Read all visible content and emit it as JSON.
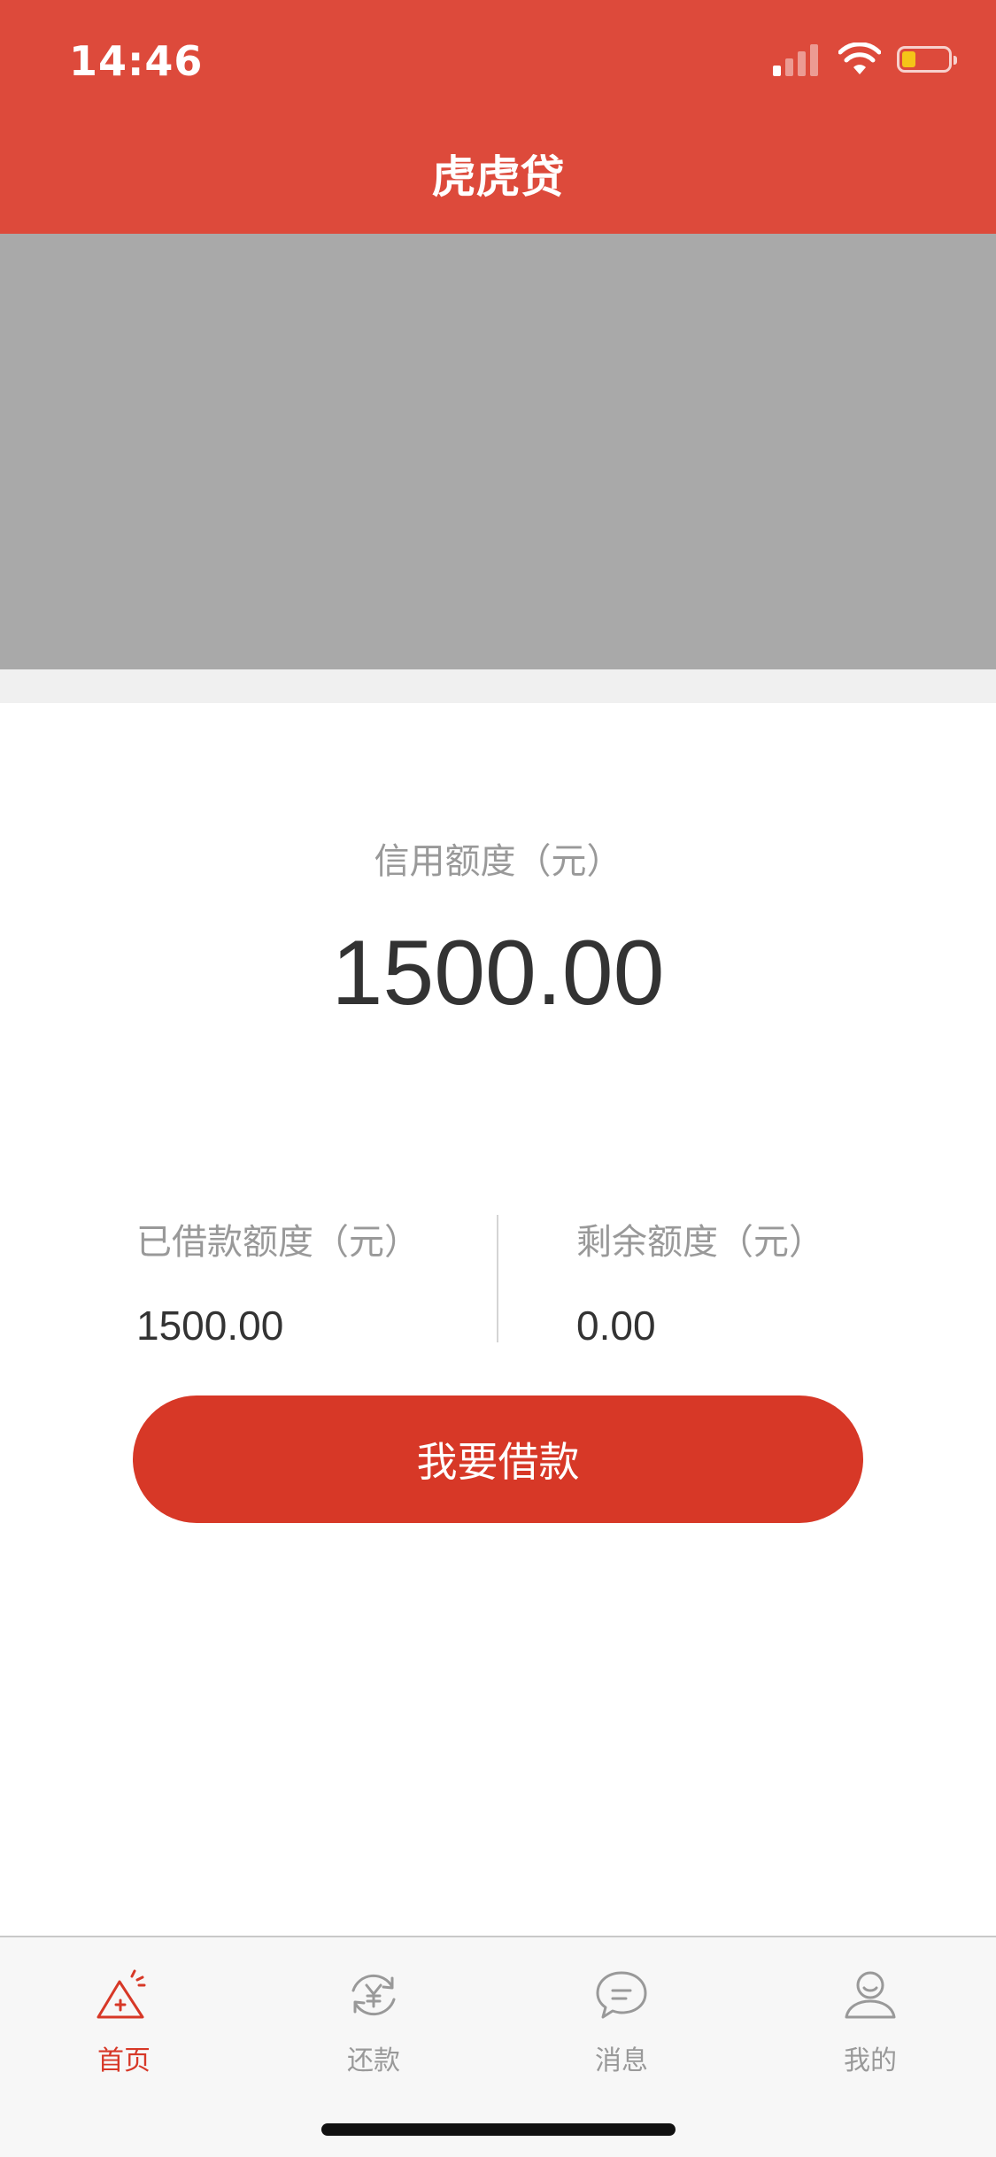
{
  "status_bar": {
    "time": "14:46"
  },
  "nav": {
    "title": "虎虎贷"
  },
  "credit": {
    "label": "信用额度（元）",
    "amount": "1500.00"
  },
  "stats": {
    "borrowed": {
      "label": "已借款额度（元）",
      "value": "1500.00"
    },
    "remaining": {
      "label": "剩余额度（元）",
      "value": "0.00"
    }
  },
  "borrow_button": "我要借款",
  "tabbar": {
    "items": [
      {
        "label": "首页",
        "icon": "home-icon",
        "active": true
      },
      {
        "label": "还款",
        "icon": "repay-icon",
        "active": false
      },
      {
        "label": "消息",
        "icon": "message-icon",
        "active": false
      },
      {
        "label": "我的",
        "icon": "profile-icon",
        "active": false
      }
    ]
  },
  "colors": {
    "brand": "#dd4a3b",
    "button": "#d73827",
    "battery": "#f5c518"
  }
}
